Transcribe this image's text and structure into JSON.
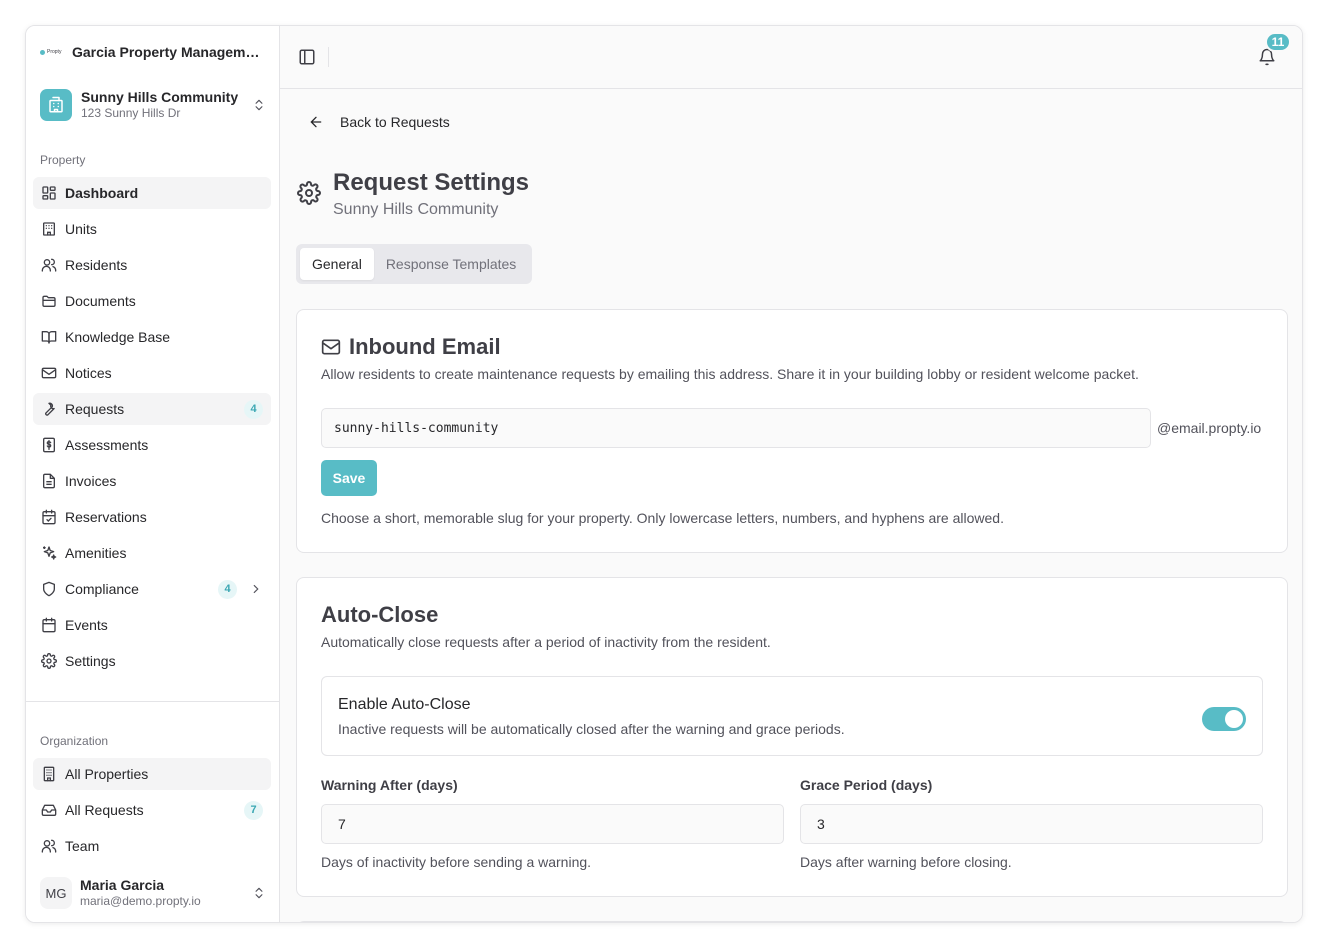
{
  "app": {
    "org_name": "Garcia Property Management",
    "logo_text": "Propty"
  },
  "property": {
    "name": "Sunny Hills Community",
    "address": "123 Sunny Hills Dr"
  },
  "sidebar": {
    "property_section_label": "Property",
    "property_items": [
      {
        "label": "Dashboard",
        "icon": "dashboard-icon"
      },
      {
        "label": "Units",
        "icon": "building-icon"
      },
      {
        "label": "Residents",
        "icon": "users-icon"
      },
      {
        "label": "Documents",
        "icon": "folder-icon"
      },
      {
        "label": "Knowledge Base",
        "icon": "book-icon"
      },
      {
        "label": "Notices",
        "icon": "mail-icon"
      },
      {
        "label": "Requests",
        "icon": "wrench-icon",
        "badge": "4"
      },
      {
        "label": "Assessments",
        "icon": "dollar-receipt-icon"
      },
      {
        "label": "Invoices",
        "icon": "file-icon"
      },
      {
        "label": "Reservations",
        "icon": "calendar-check-icon"
      },
      {
        "label": "Amenities",
        "icon": "sparkles-icon"
      },
      {
        "label": "Compliance",
        "icon": "shield-icon",
        "badge": "4"
      },
      {
        "label": "Events",
        "icon": "calendar-icon"
      },
      {
        "label": "Settings",
        "icon": "gear-icon"
      }
    ],
    "org_section_label": "Organization",
    "org_items": [
      {
        "label": "All Properties",
        "icon": "building-grid-icon"
      },
      {
        "label": "All Requests",
        "icon": "inbox-icon",
        "badge": "7"
      },
      {
        "label": "Team",
        "icon": "users-icon"
      }
    ],
    "user": {
      "initials": "MG",
      "name": "Maria Garcia",
      "email": "maria@demo.propty.io"
    }
  },
  "topbar": {
    "notification_count": "11"
  },
  "page": {
    "back_label": "Back to Requests",
    "title": "Request Settings",
    "subtitle": "Sunny Hills Community",
    "tabs": [
      {
        "label": "General",
        "active": true
      },
      {
        "label": "Response Templates",
        "active": false
      }
    ]
  },
  "inbound_email": {
    "title": "Inbound Email",
    "description": "Allow residents to create maintenance requests by emailing this address. Share it in your building lobby or resident welcome packet.",
    "slug_value": "sunny-hills-community",
    "domain_suffix": "@email.propty.io",
    "save_label": "Save",
    "hint": "Choose a short, memorable slug for your property. Only lowercase letters, numbers, and hyphens are allowed."
  },
  "auto_close": {
    "title": "Auto-Close",
    "description": "Automatically close requests after a period of inactivity from the resident.",
    "toggle_title": "Enable Auto-Close",
    "toggle_description": "Inactive requests will be automatically closed after the warning and grace periods.",
    "enabled": true,
    "warning_label": "Warning After (days)",
    "warning_value": "7",
    "warning_hint": "Days of inactivity before sending a warning.",
    "grace_label": "Grace Period (days)",
    "grace_value": "3",
    "grace_hint": "Days after warning before closing."
  },
  "colors": {
    "accent": "#58bcc6",
    "badge_bg": "#e6f6f7",
    "badge_text": "#3aa7b3"
  }
}
